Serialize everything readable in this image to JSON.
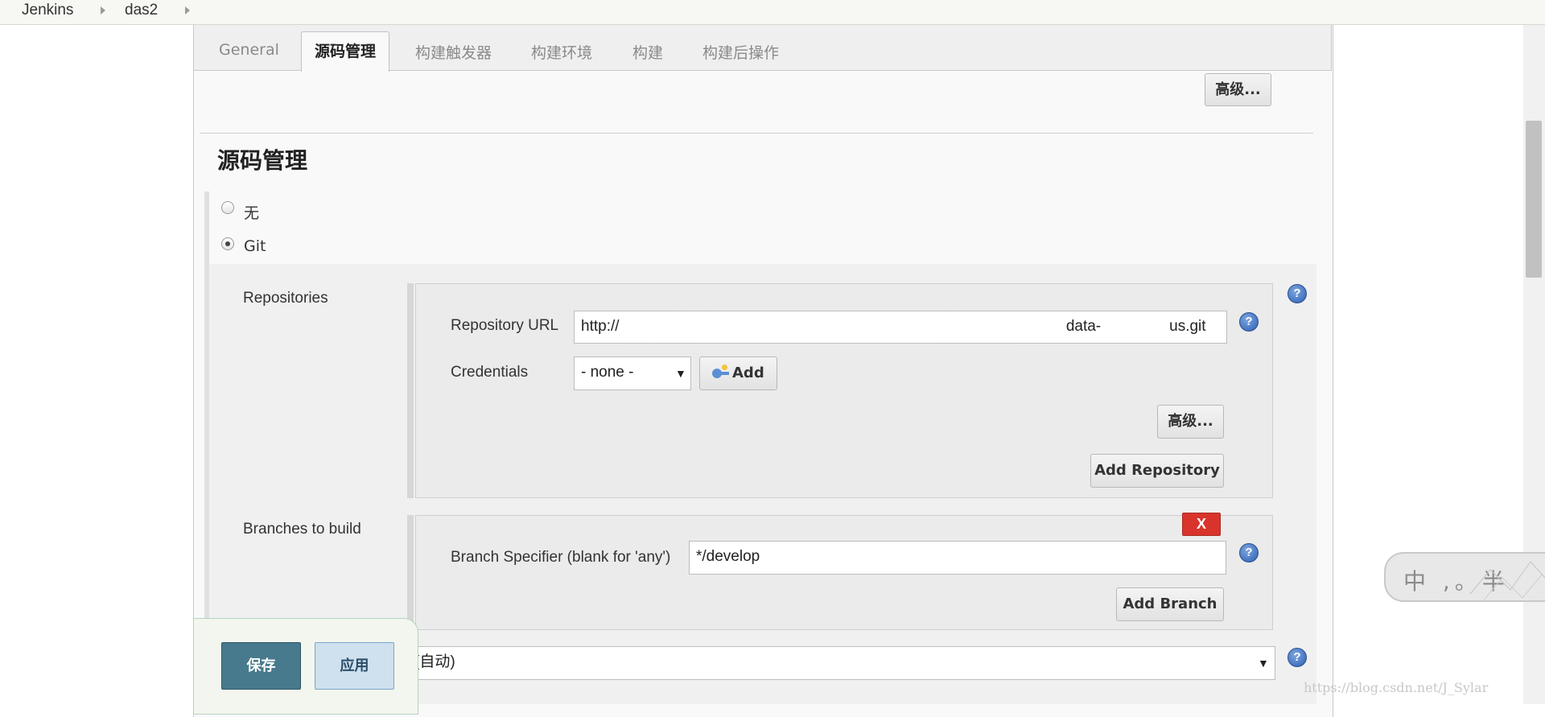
{
  "breadcrumb": {
    "items": [
      "Jenkins",
      "das2"
    ]
  },
  "tabs": [
    {
      "label": "General"
    },
    {
      "label": "源码管理"
    },
    {
      "label": "构建触发器"
    },
    {
      "label": "构建环境"
    },
    {
      "label": "构建"
    },
    {
      "label": "构建后操作"
    }
  ],
  "general": {
    "advanced_label": "高级..."
  },
  "scm": {
    "title": "源码管理",
    "options": [
      {
        "label": "无",
        "checked": false
      },
      {
        "label": "Git",
        "checked": true
      }
    ],
    "repositories": {
      "label": "Repositories",
      "url_label": "Repository URL",
      "url_value": "http://                              .git",
      "url_visible_start": "http://",
      "url_visible_mid": "data-",
      "url_visible_end": "us.git",
      "credentials_label": "Credentials",
      "credentials_value": "- none -",
      "add_label": "Add",
      "advanced_label": "高级...",
      "add_repository_label": "Add Repository"
    },
    "branches": {
      "label": "Branches to build",
      "delete_label": "X",
      "specifier_label": "Branch Specifier (blank for 'any')",
      "specifier_value": "*/develop",
      "add_branch_label": "Add Branch"
    },
    "browser": {
      "value": "(自动)"
    }
  },
  "footer": {
    "save_label": "保存",
    "apply_label": "应用"
  },
  "overlay": {
    "ime_text": "中 ,。半",
    "watermark": "https://blog.csdn.net/J_Sylar"
  },
  "colors": {
    "save": "#477a8c",
    "apply": "#cfe0ee",
    "delete": "#d9342b",
    "help": "#2d5fb3"
  }
}
